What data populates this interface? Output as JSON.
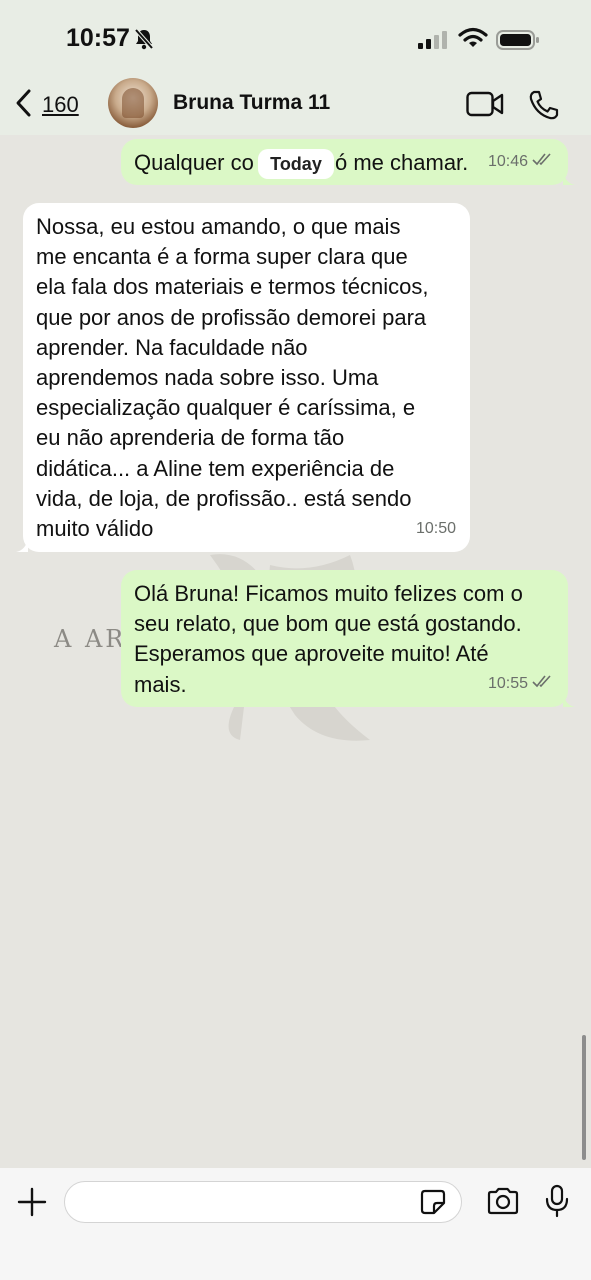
{
  "status_bar": {
    "time": "10:57",
    "icons": [
      "bell-slash-icon",
      "signal-icon",
      "wifi-icon",
      "battery-icon"
    ]
  },
  "header": {
    "back_count": "160",
    "contact_name": "Bruna Turma 11",
    "icons": [
      "chevron-left-icon",
      "video-call-icon",
      "phone-icon"
    ]
  },
  "chat": {
    "date_separator": "Today",
    "watermark_text": "A ART",
    "messages": [
      {
        "direction": "outgoing",
        "text": "Qualquer coisa é só me chamar.",
        "visible_fragments": [
          "Qualquer co",
          "ó me chamar."
        ],
        "time": "10:46",
        "read": true
      },
      {
        "direction": "incoming",
        "text": "Nossa, eu estou amando, o que mais\nme encanta é a forma super clara que\nela fala dos materiais e termos técnicos,\nque por anos de profissão demorei para\naprender. Na faculdade não\naprendemos nada sobre isso. Uma\nespecialização qualquer é caríssima, e\neu não aprenderia de forma tão\ndidática... a Aline tem experiência de\nvida, de loja, de profissão.. está sendo\nmuito válido",
        "time": "10:50"
      },
      {
        "direction": "outgoing",
        "text": "Olá Bruna! Ficamos muito felizes com o\nseu relato, que bom que está gostando.\nEsperamos que aproveite muito! Até\nmais.",
        "time": "10:55",
        "read": true
      }
    ]
  },
  "input_bar": {
    "placeholder": "",
    "icons": [
      "plus-icon",
      "sticker-icon",
      "camera-icon",
      "microphone-icon"
    ]
  },
  "colors": {
    "outgoing_bubble": "#dbf8c6",
    "incoming_bubble": "#ffffff",
    "chat_background": "#e6e5e0",
    "header_background": "#e8ede5"
  }
}
